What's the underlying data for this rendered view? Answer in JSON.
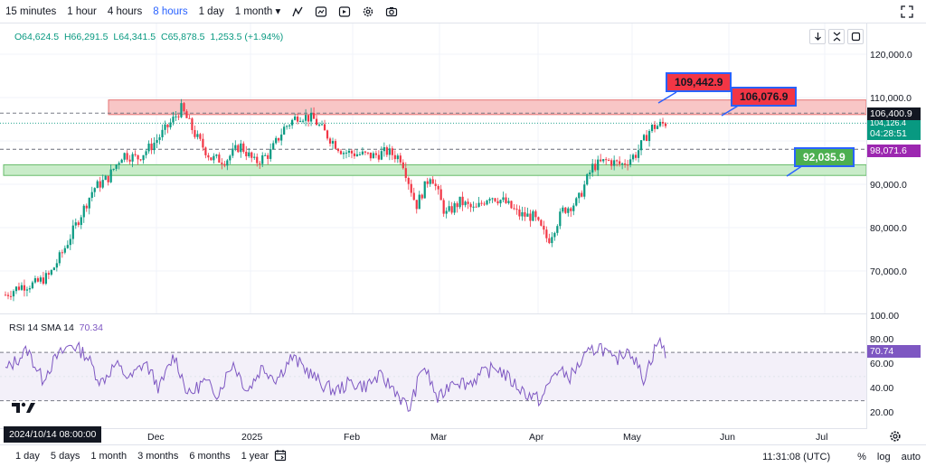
{
  "toolbar": {
    "timeframes": [
      "15 minutes",
      "1 hour",
      "4 hours",
      "8 hours",
      "1 day",
      "1 month"
    ],
    "active_timeframe": "8 hours",
    "icons": [
      "indicators-icon",
      "compare-icon",
      "replay-icon",
      "settings-icon",
      "camera-icon",
      "fullscreen-icon"
    ]
  },
  "legend": {
    "open": "O64,624.5",
    "high": "H66,291.5",
    "low": "L64,341.5",
    "close": "C65,878.5",
    "change": "1,253.5 (+1.94%)"
  },
  "rsi_legend": {
    "name": "RSI 14 SMA 14",
    "value": "70.34"
  },
  "price_axis": {
    "ticks": [
      "120,000.0",
      "110,000.0",
      "90,000.0",
      "80,000.0",
      "70,000.0"
    ],
    "badges": {
      "last_price": "106,400.9",
      "countdown": "04:28:51",
      "last_value_partial": "104,126.4",
      "line_price": "98,071.6"
    }
  },
  "rsi_axis": {
    "ticks": [
      "100.00",
      "80.00",
      "60.00",
      "40.00",
      "20.00"
    ],
    "badge": "70.74"
  },
  "callouts": {
    "upper_level": "109,442.9",
    "zone_top": "106,076.9",
    "support": "92,035.9"
  },
  "time_axis": {
    "labels": [
      "Dec",
      "2025",
      "Feb",
      "Mar",
      "Apr",
      "May",
      "Jun",
      "Jul"
    ],
    "cursor_label": "2024/10/14  08:00:00"
  },
  "bottom": {
    "ranges": [
      "1 day",
      "5 days",
      "1 month",
      "3 months",
      "6 months",
      "1 year"
    ],
    "clock": "11:31:08 (UTC)",
    "percent": "%",
    "log": "log",
    "auto": "auto"
  },
  "colors": {
    "up": "#089981",
    "down": "#f23645",
    "rsi": "#7e57c2",
    "accent": "#2962ff",
    "resistance_zone": "#f8c6c6",
    "support_zone": "#c9ecc9",
    "callout_red": "#f23645",
    "callout_green": "#4caf50"
  },
  "chart_data": {
    "type": "candlestick",
    "symbol_interval": "8 hours",
    "ylim": [
      62000,
      124000
    ],
    "resistance_zone": [
      106076.9,
      109442.9
    ],
    "support_zone": [
      92035.9,
      94500
    ],
    "dashed_levels": [
      106400.9,
      98071.6
    ],
    "close_path": [
      {
        "t": 0,
        "v": 64500
      },
      {
        "t": 4,
        "v": 66500
      },
      {
        "t": 8,
        "v": 67000
      },
      {
        "t": 12,
        "v": 69000
      },
      {
        "t": 16,
        "v": 75000
      },
      {
        "t": 20,
        "v": 82000
      },
      {
        "t": 24,
        "v": 89000
      },
      {
        "t": 28,
        "v": 91500
      },
      {
        "t": 32,
        "v": 97000
      },
      {
        "t": 36,
        "v": 96000
      },
      {
        "t": 40,
        "v": 99000
      },
      {
        "t": 44,
        "v": 103000
      },
      {
        "t": 48,
        "v": 107500
      },
      {
        "t": 52,
        "v": 101000
      },
      {
        "t": 56,
        "v": 96000
      },
      {
        "t": 60,
        "v": 95500
      },
      {
        "t": 64,
        "v": 99000
      },
      {
        "t": 68,
        "v": 95000
      },
      {
        "t": 72,
        "v": 97000
      },
      {
        "t": 76,
        "v": 103000
      },
      {
        "t": 80,
        "v": 106000
      },
      {
        "t": 84,
        "v": 105000
      },
      {
        "t": 88,
        "v": 101000
      },
      {
        "t": 92,
        "v": 97500
      },
      {
        "t": 96,
        "v": 97000
      },
      {
        "t": 100,
        "v": 96500
      },
      {
        "t": 104,
        "v": 97500
      },
      {
        "t": 108,
        "v": 96000
      },
      {
        "t": 112,
        "v": 85000
      },
      {
        "t": 116,
        "v": 92500
      },
      {
        "t": 120,
        "v": 83000
      },
      {
        "t": 124,
        "v": 86000
      },
      {
        "t": 128,
        "v": 84000
      },
      {
        "t": 132,
        "v": 87500
      },
      {
        "t": 136,
        "v": 86000
      },
      {
        "t": 140,
        "v": 83000
      },
      {
        "t": 144,
        "v": 82500
      },
      {
        "t": 148,
        "v": 77000
      },
      {
        "t": 152,
        "v": 84000
      },
      {
        "t": 156,
        "v": 86000
      },
      {
        "t": 160,
        "v": 94000
      },
      {
        "t": 164,
        "v": 95500
      },
      {
        "t": 168,
        "v": 94500
      },
      {
        "t": 172,
        "v": 97000
      },
      {
        "t": 176,
        "v": 103000
      },
      {
        "t": 180,
        "v": 104100
      }
    ],
    "rsi_levels": [
      70,
      30
    ],
    "rsi_path": [
      {
        "t": 0,
        "v": 55
      },
      {
        "t": 6,
        "v": 72
      },
      {
        "t": 10,
        "v": 48
      },
      {
        "t": 14,
        "v": 66
      },
      {
        "t": 18,
        "v": 77
      },
      {
        "t": 22,
        "v": 68
      },
      {
        "t": 26,
        "v": 45
      },
      {
        "t": 30,
        "v": 60
      },
      {
        "t": 34,
        "v": 48
      },
      {
        "t": 38,
        "v": 62
      },
      {
        "t": 42,
        "v": 40
      },
      {
        "t": 46,
        "v": 68
      },
      {
        "t": 50,
        "v": 34
      },
      {
        "t": 54,
        "v": 46
      },
      {
        "t": 58,
        "v": 36
      },
      {
        "t": 62,
        "v": 62
      },
      {
        "t": 66,
        "v": 38
      },
      {
        "t": 70,
        "v": 58
      },
      {
        "t": 74,
        "v": 48
      },
      {
        "t": 78,
        "v": 66
      },
      {
        "t": 82,
        "v": 56
      },
      {
        "t": 86,
        "v": 44
      },
      {
        "t": 90,
        "v": 38
      },
      {
        "t": 94,
        "v": 45
      },
      {
        "t": 98,
        "v": 42
      },
      {
        "t": 102,
        "v": 50
      },
      {
        "t": 106,
        "v": 40
      },
      {
        "t": 110,
        "v": 22
      },
      {
        "t": 114,
        "v": 60
      },
      {
        "t": 118,
        "v": 30
      },
      {
        "t": 122,
        "v": 48
      },
      {
        "t": 126,
        "v": 44
      },
      {
        "t": 130,
        "v": 52
      },
      {
        "t": 134,
        "v": 58
      },
      {
        "t": 138,
        "v": 46
      },
      {
        "t": 142,
        "v": 36
      },
      {
        "t": 146,
        "v": 30
      },
      {
        "t": 150,
        "v": 55
      },
      {
        "t": 154,
        "v": 50
      },
      {
        "t": 158,
        "v": 66
      },
      {
        "t": 162,
        "v": 76
      },
      {
        "t": 166,
        "v": 62
      },
      {
        "t": 170,
        "v": 74
      },
      {
        "t": 174,
        "v": 48
      },
      {
        "t": 178,
        "v": 80
      },
      {
        "t": 180,
        "v": 70
      }
    ]
  }
}
